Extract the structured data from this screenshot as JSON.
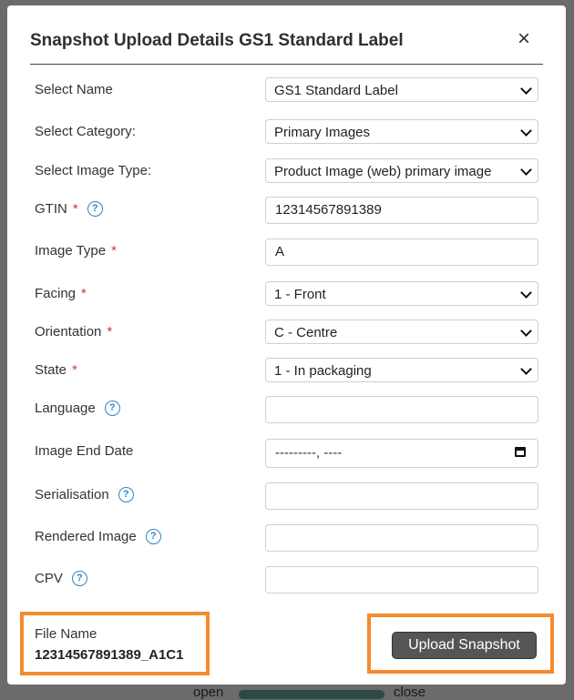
{
  "background": {
    "left_text": "open",
    "right_text": "close"
  },
  "modal": {
    "title": "Snapshot Upload Details GS1 Standard Label",
    "close_label": "×"
  },
  "fields": {
    "select_name": {
      "label": "Select Name",
      "value": "GS1 Standard Label"
    },
    "select_category": {
      "label": "Select Category:",
      "value": "Primary Images"
    },
    "select_image_type": {
      "label": "Select Image Type:",
      "value": "Product Image (web) primary image"
    },
    "gtin": {
      "label": "GTIN",
      "required": "*",
      "value": "12314567891389"
    },
    "image_type": {
      "label": "Image Type",
      "required": "*",
      "value": "A"
    },
    "facing": {
      "label": "Facing",
      "required": "*",
      "value": "1 - Front"
    },
    "orientation": {
      "label": "Orientation",
      "required": "*",
      "value": "C - Centre"
    },
    "state": {
      "label": "State",
      "required": "*",
      "value": "1 - In packaging"
    },
    "language": {
      "label": "Language",
      "value": ""
    },
    "image_end_date": {
      "label": "Image End Date",
      "value": "---------, ----"
    },
    "serialisation": {
      "label": "Serialisation",
      "value": ""
    },
    "rendered_image": {
      "label": "Rendered Image",
      "value": ""
    },
    "cpv": {
      "label": "CPV",
      "value": ""
    }
  },
  "help_icon": "?",
  "file": {
    "label": "File Name",
    "value": "12314567891389_A1C1"
  },
  "upload_button": "Upload Snapshot",
  "colors": {
    "accent_border": "#f58a2e",
    "required": "#d9302c",
    "help": "#2a86c8",
    "button": "#555555"
  }
}
